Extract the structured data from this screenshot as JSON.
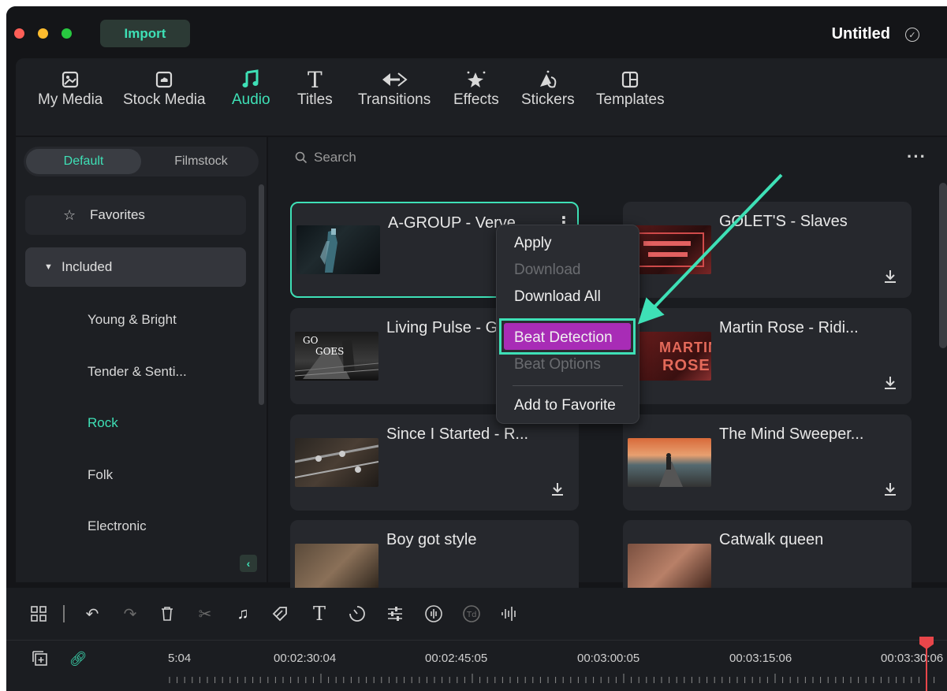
{
  "titlebar": {
    "import_label": "Import",
    "doc_title": "Untitled"
  },
  "toolbar": {
    "tabs": [
      {
        "label": "My Media",
        "icon": "media-icon"
      },
      {
        "label": "Stock Media",
        "icon": "cloud-icon"
      },
      {
        "label": "Audio",
        "icon": "music-note-icon",
        "active": true
      },
      {
        "label": "Titles",
        "icon": "text-icon"
      },
      {
        "label": "Transitions",
        "icon": "transition-icon"
      },
      {
        "label": "Effects",
        "icon": "sparkle-icon"
      },
      {
        "label": "Stickers",
        "icon": "sticker-icon"
      },
      {
        "label": "Templates",
        "icon": "template-icon"
      }
    ]
  },
  "sidebar": {
    "segments": {
      "default": "Default",
      "filmstock": "Filmstock"
    },
    "favorites": "Favorites",
    "included": "Included",
    "categories": [
      "Young & Bright",
      "Tender & Senti...",
      "Rock",
      "Folk",
      "Electronic"
    ],
    "active_category": "Rock"
  },
  "main": {
    "search_placeholder": "Search",
    "cards": [
      {
        "title": "A-GROUP - Verve",
        "selected": true
      },
      {
        "title": "GOLET'S - Slaves"
      },
      {
        "title": "Living Pulse - G"
      },
      {
        "title": "Martin Rose - Ridi..."
      },
      {
        "title": "Since I Started - R..."
      },
      {
        "title": "The Mind Sweeper..."
      },
      {
        "title": "Boy got style"
      },
      {
        "title": "Catwalk queen"
      }
    ],
    "thumb_text": {
      "card3_line1": "GO",
      "card3_line2": "GOES",
      "card4_line1": "MARTIN",
      "card4_line2": "ROSE"
    }
  },
  "context_menu": {
    "items": [
      {
        "label": "Apply",
        "enabled": true
      },
      {
        "label": "Download",
        "enabled": false
      },
      {
        "label": "Download All",
        "enabled": true
      },
      {
        "label": "Beat Detection",
        "enabled": true,
        "highlighted": true
      },
      {
        "label": "Beat Options",
        "enabled": false
      },
      {
        "label": "Add to Favorite",
        "enabled": true
      }
    ]
  },
  "timeline": {
    "timestamps": [
      "5:04",
      "00:02:30:04",
      "00:02:45:05",
      "00:03:00:05",
      "00:03:15:06",
      "00:03:30:06"
    ]
  },
  "colors": {
    "accent": "#3ee0b6",
    "highlight": "#a82cb6",
    "playhead": "#e8464a"
  }
}
